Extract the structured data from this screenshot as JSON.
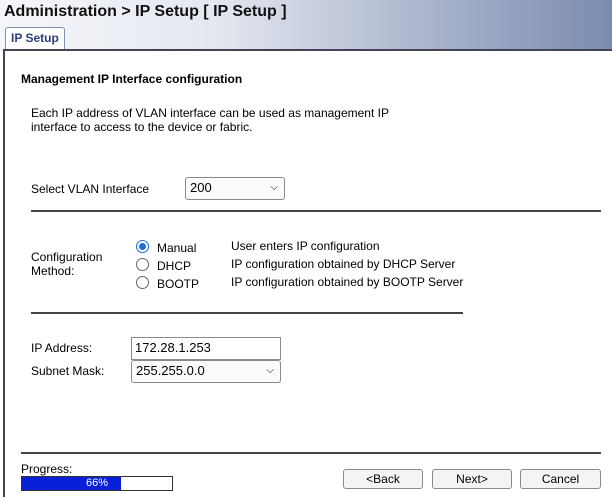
{
  "header": {
    "title": "Administration > IP Setup [ IP Setup ]"
  },
  "tabs": [
    {
      "label": "IP Setup"
    }
  ],
  "section": {
    "title": "Management IP Interface configuration",
    "description": "Each IP address of VLAN interface can be used as management IP interface to access to the device or fabric."
  },
  "vlan": {
    "label": "Select VLAN Interface",
    "value": "200"
  },
  "config": {
    "label_line1": "Configuration",
    "label_line2": "Method:",
    "options": [
      {
        "label": "Manual",
        "description": "User enters IP configuration",
        "selected": true
      },
      {
        "label": "DHCP",
        "description": "IP configuration obtained by DHCP Server",
        "selected": false
      },
      {
        "label": "BOOTP",
        "description": "IP configuration obtained by BOOTP Server",
        "selected": false
      }
    ]
  },
  "ip": {
    "label": "IP Address:",
    "value": "172.28.1.253"
  },
  "mask": {
    "label": "Subnet Mask:",
    "value": "255.255.0.0"
  },
  "progress": {
    "label": "Progress:",
    "value_text": "66%",
    "fraction": 0.66,
    "color": "#0a1fd8"
  },
  "buttons": {
    "back": "<Back",
    "next": "Next>",
    "cancel": "Cancel"
  },
  "icons": {
    "dropdown": "chevron-down-icon"
  }
}
